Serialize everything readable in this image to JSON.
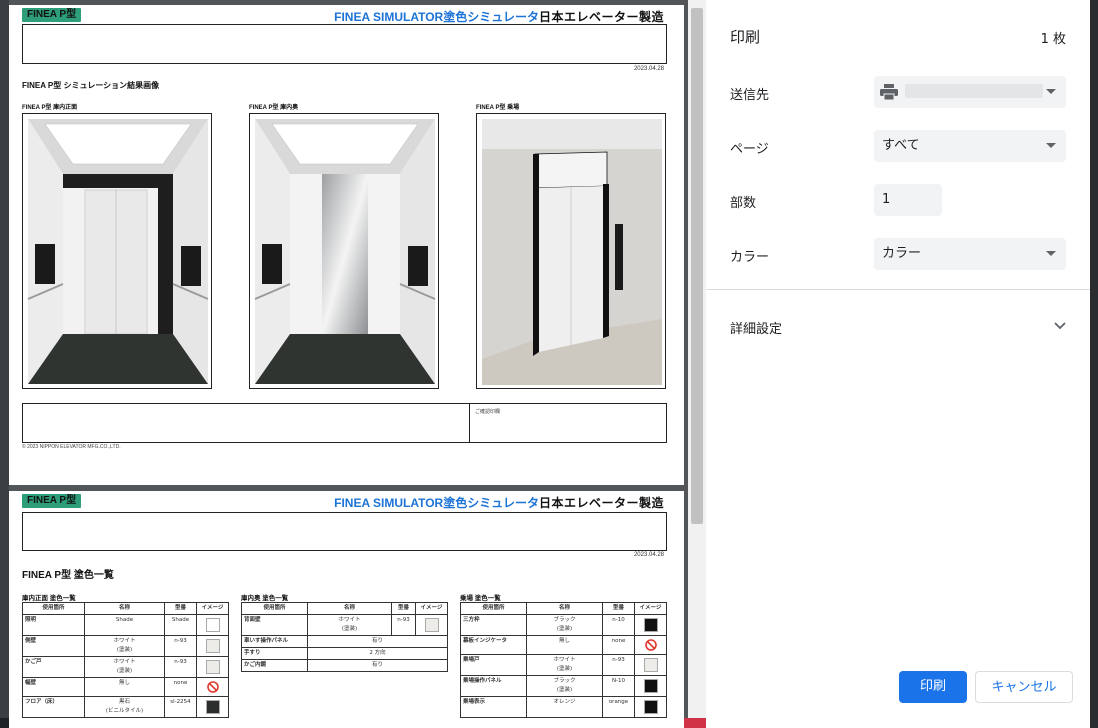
{
  "preview": {
    "page1": {
      "badge": "FINEA P型",
      "header_title": "FINEA SIMULATOR塗色シミュレータ",
      "header_company": "日本エレベーター製造",
      "date": "2023.04.28",
      "section_title": "FINEA P型 シミュレーション結果画像",
      "captions": [
        "FINEA P型 庫内正面",
        "FINEA P型 庫内奥",
        "FINEA P型 乗場"
      ],
      "confirm_label": "ご確認印欄",
      "copyright": "© 2023 NIPPON ELEVATOR MFG.CO.,LTD."
    },
    "page2": {
      "badge": "FINEA P型",
      "header_title": "FINEA SIMULATOR塗色シミュレータ",
      "header_company": "日本エレベーター製造",
      "date": "2023.04.28",
      "section_title": "FINEA P型 塗色一覧",
      "tables": [
        {
          "title": "庫内正面 塗色一覧",
          "headers": [
            "使用箇所",
            "名称",
            "型番",
            "イメージ"
          ],
          "rows": [
            {
              "place": "照明",
              "name": "Shade",
              "code": "Shade",
              "swatch": "#ffffff"
            },
            {
              "place": "側壁",
              "name": "ホワイト\n(塗装)",
              "code": "n-93",
              "swatch": "#eeece8"
            },
            {
              "place": "かご戸",
              "name": "ホワイト\n(塗装)",
              "code": "n-93",
              "swatch": "#eeece8"
            },
            {
              "place": "幅壁",
              "name": "無し",
              "code": "none",
              "swatch": "none"
            },
            {
              "place": "フロア（床）",
              "name": "黒石\n(ビニルタイル)",
              "code": "sl-2254",
              "swatch": "#2b2e2c"
            }
          ]
        },
        {
          "title": "庫内奥 塗色一覧",
          "headers": [
            "使用箇所",
            "名称",
            "型番",
            "イメージ"
          ],
          "rows": [
            {
              "place": "背面壁",
              "name": "ホワイト\n(塗装)",
              "code": "n-93",
              "swatch": "#eeece8"
            },
            {
              "place": "車いす操作パネル",
              "name": "有り",
              "code": "",
              "swatch": ""
            },
            {
              "place": "手すり",
              "name": "2 方向",
              "code": "",
              "swatch": ""
            },
            {
              "place": "かご内鏡",
              "name": "有り",
              "code": "",
              "swatch": ""
            }
          ]
        },
        {
          "title": "乗場 塗色一覧",
          "headers": [
            "使用箇所",
            "名称",
            "型番",
            "イメージ"
          ],
          "rows": [
            {
              "place": "三方枠",
              "name": "ブラック\n(塗装)",
              "code": "n-10",
              "swatch": "#111111"
            },
            {
              "place": "幕板インジケータ",
              "name": "無し",
              "code": "none",
              "swatch": "none"
            },
            {
              "place": "乗場戸",
              "name": "ホワイト\n(塗装)",
              "code": "n-93",
              "swatch": "#eeece8"
            },
            {
              "place": "乗場操作パネル",
              "name": "ブラック\n(塗装)",
              "code": "N-10",
              "swatch": "#111111"
            },
            {
              "place": "乗場表示",
              "name": "オレンジ",
              "code": "orange",
              "swatch": "#111111"
            }
          ]
        }
      ]
    }
  },
  "print_panel": {
    "title": "印刷",
    "sheet_count": "1 枚",
    "destination_label": "送信先",
    "destination_value": "",
    "pages_label": "ページ",
    "pages_value": "すべて",
    "copies_label": "部数",
    "copies_value": "1",
    "color_label": "カラー",
    "color_value": "カラー",
    "advanced_label": "詳細設定",
    "print_button": "印刷",
    "cancel_button": "キャンセル"
  },
  "colors": {
    "accent": "#1a73e8",
    "badge_green": "#2e9e7a",
    "header_blue": "#1d73d6"
  }
}
